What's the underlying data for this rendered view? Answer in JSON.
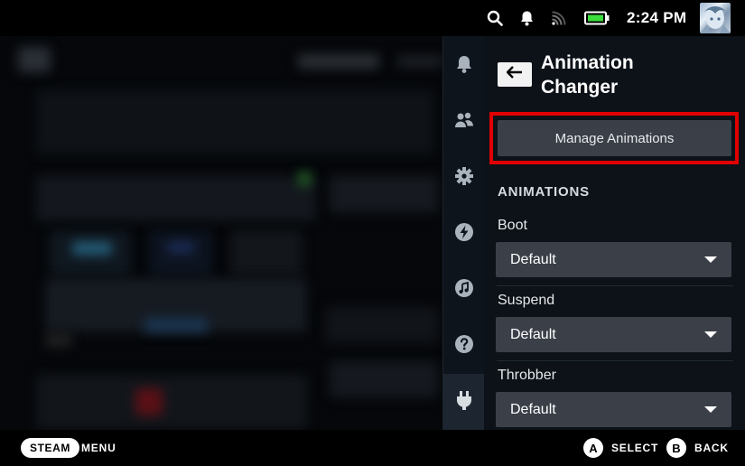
{
  "status_bar": {
    "time": "2:24 PM",
    "icons": [
      "search-icon",
      "bell-icon",
      "wifi-icon",
      "battery-icon"
    ],
    "battery_color": "#3cdc3c"
  },
  "quick_access_tabs": [
    {
      "icon": "bell-icon",
      "active": false
    },
    {
      "icon": "friends-icon",
      "active": false
    },
    {
      "icon": "gear-icon",
      "active": false
    },
    {
      "icon": "performance-icon",
      "active": false
    },
    {
      "icon": "music-icon",
      "active": false
    },
    {
      "icon": "help-icon",
      "active": false
    },
    {
      "icon": "plugin-icon",
      "active": true
    }
  ],
  "panel": {
    "title_line1": "Animation",
    "title_line2": "Changer",
    "manage_button": "Manage Animations",
    "highlight_color": "#e00000",
    "section": "ANIMATIONS",
    "fields": [
      {
        "label": "Boot",
        "value": "Default"
      },
      {
        "label": "Suspend",
        "value": "Default"
      },
      {
        "label": "Throbber",
        "value": "Default"
      }
    ]
  },
  "bottom_bar": {
    "steam_label": "STEAM",
    "menu_label": "MENU",
    "a_button": "A",
    "select_label": "SELECT",
    "b_button": "B",
    "back_label": "BACK"
  }
}
